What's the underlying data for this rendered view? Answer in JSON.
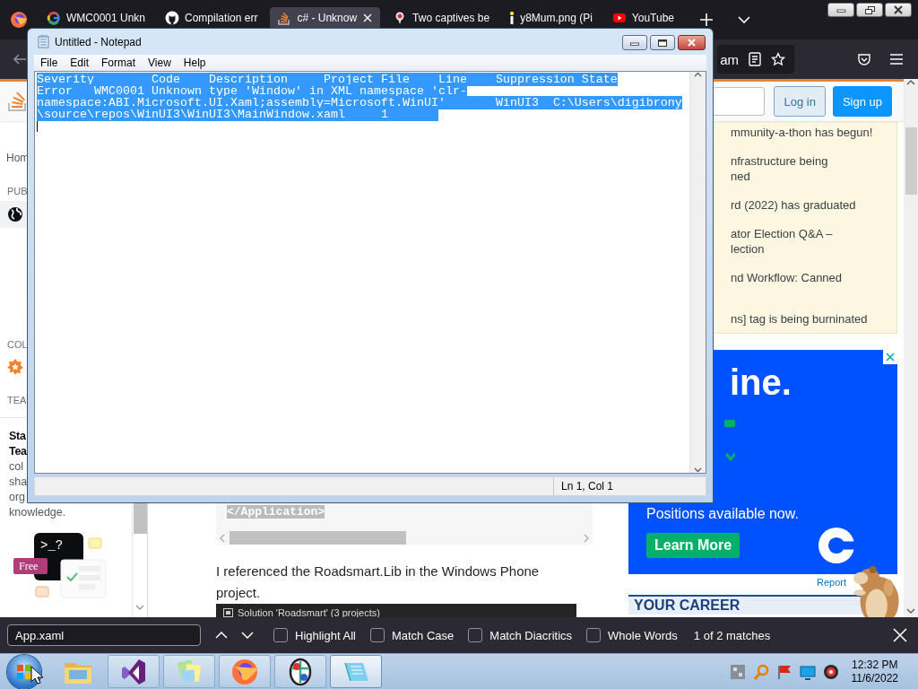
{
  "browser": {
    "tabs": [
      {
        "kind": "google",
        "title": "WMC0001 Unkn",
        "selected": false
      },
      {
        "kind": "github",
        "title": "Compilation err",
        "selected": false
      },
      {
        "kind": "stack",
        "title": "c# - Unknow",
        "selected": true
      },
      {
        "kind": "pin",
        "title": "Two captives be",
        "selected": false
      },
      {
        "kind": "info",
        "title": "y8Mum.png (Pi",
        "selected": false
      },
      {
        "kind": "video",
        "title": "YouTube",
        "selected": false
      }
    ],
    "address_bar": {
      "value": "am"
    },
    "page": {
      "header": {
        "buttons": [
          {
            "kind": "secondary",
            "label": "Log in"
          },
          {
            "kind": "primary",
            "label": "Sign up"
          }
        ]
      },
      "left_nav": [
        {
          "kind": "link",
          "text": "Hom",
          "selected": false
        },
        {
          "kind": "heading",
          "text": "PUB"
        },
        {
          "kind": "globe-link",
          "selected": true
        },
        {
          "kind": "heading",
          "text": "COL"
        },
        {
          "kind": "star-link",
          "selected": false
        },
        {
          "kind": "heading",
          "text": "TEA"
        }
      ],
      "teams_card": {
        "title_lines": [
          "Sta",
          "Tea"
        ],
        "body_lines": [
          "col",
          "sha",
          "org",
          "knowledge."
        ],
        "illustration_text": ">_?",
        "badge": "Free"
      },
      "post": {
        "code_line": {
          "text": "</Application>",
          "highlighted": true
        },
        "paragraph": "I referenced the Roadsmart.Lib in the Windows Phone project.",
        "screenshot_caption": "Solution 'Roadsmart' (3 projects)"
      },
      "blog_items": [
        {
          "lines": [
            "mmunity-a-thon has begun!"
          ]
        },
        {
          "lines": [
            "nfrastructure being",
            "ned"
          ]
        },
        {
          "lines": [
            "rd (2022) has graduated"
          ]
        },
        {
          "lines": [
            "ator Election Q&A –",
            "lection"
          ]
        },
        {
          "lines": [
            "nd Workflow: Canned"
          ]
        },
        {
          "lines": [
            "ns] tag is being burninated"
          ]
        }
      ],
      "ad": {
        "headline": "ine.",
        "text": "Positions available now.",
        "button": "Learn More",
        "report": "Report"
      },
      "career_banner": "YOUR CAREER"
    },
    "find_bar": {
      "query": "App.xaml",
      "options": [
        {
          "label": "Highlight All",
          "checked": false
        },
        {
          "label": "Match Case",
          "checked": false
        },
        {
          "label": "Match Diacritics",
          "checked": false
        },
        {
          "label": "Whole Words",
          "checked": false
        }
      ],
      "status": "1 of 2 matches"
    }
  },
  "notepad": {
    "title": "Untitled - Notepad",
    "menu": [
      "File",
      "Edit",
      "Format",
      "View",
      "Help"
    ],
    "lines": [
      "Severity\tCode\tDescription\tProject File\tLine\tSuppression State",
      "Error\tWMC0001 Unknown type 'Window' in XML namespace 'clr-",
      "namespace:ABI.Microsoft.UI.Xaml;assembly=Microsoft.WinUI'\tWinUI3\tC:\\Users\\digibrony",
      "\\source\\repos\\WinUI3\\WinUI3\\MainWindow.xaml\t1\t"
    ],
    "selected": true,
    "status": "Ln 1, Col 1"
  },
  "taskbar": {
    "apps": [
      {
        "kind": "folder",
        "running": false,
        "selected": false
      },
      {
        "kind": "ribbon",
        "running": true,
        "selected": false
      },
      {
        "kind": "notes",
        "running": true,
        "selected": false
      },
      {
        "kind": "globe",
        "running": true,
        "selected": false
      },
      {
        "kind": "wheel",
        "running": true,
        "selected": false
      },
      {
        "kind": "notepad",
        "running": true,
        "selected": true
      }
    ],
    "clock": {
      "time": "12:32 PM",
      "date": "11/6/2022"
    }
  }
}
